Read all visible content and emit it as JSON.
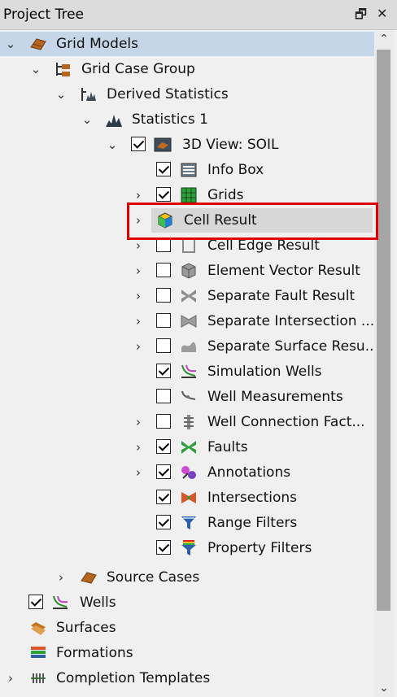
{
  "window": {
    "title": "Project Tree",
    "float_glyph": "🗗",
    "close_glyph": "✕"
  },
  "tree": [
    {
      "label": "Grid Models",
      "icon": "grid-models-icon"
    },
    {
      "label": "Grid Case Group",
      "icon": "grid-case-group-icon"
    },
    {
      "label": "Derived Statistics",
      "icon": "derived-statistics-icon"
    },
    {
      "label": "Statistics 1",
      "icon": "statistics-icon"
    },
    {
      "label": "3D View: SOIL",
      "icon": "view-3d-icon",
      "checked": true
    },
    {
      "label": "Info Box",
      "icon": "info-box-icon",
      "checked": true
    },
    {
      "label": "Grids",
      "icon": "grids-icon",
      "checked": true
    },
    {
      "label": "Cell Result",
      "icon": "cell-result-icon"
    },
    {
      "label": "Cell Edge Result",
      "icon": "cell-edge-result-icon",
      "checked": false
    },
    {
      "label": "Element Vector Result",
      "icon": "element-vector-result-icon",
      "checked": false
    },
    {
      "label": "Separate Fault Result",
      "icon": "separate-fault-result-icon",
      "checked": false
    },
    {
      "label": "Separate Intersection ...",
      "icon": "separate-intersection-icon",
      "checked": false
    },
    {
      "label": "Separate Surface Resu...",
      "icon": "separate-surface-icon",
      "checked": false
    },
    {
      "label": "Simulation Wells",
      "icon": "simulation-wells-icon",
      "checked": true
    },
    {
      "label": "Well Measurements",
      "icon": "well-measurements-icon",
      "checked": false
    },
    {
      "label": "Well Connection Fact...",
      "icon": "well-connection-icon",
      "checked": false
    },
    {
      "label": "Faults",
      "icon": "faults-icon",
      "checked": true
    },
    {
      "label": "Annotations",
      "icon": "annotations-icon",
      "checked": true
    },
    {
      "label": "Intersections",
      "icon": "intersections-icon",
      "checked": true
    },
    {
      "label": "Range Filters",
      "icon": "range-filters-icon",
      "checked": true
    },
    {
      "label": "Property Filters",
      "icon": "property-filters-icon",
      "checked": true
    },
    {
      "label": "Source Cases",
      "icon": "source-cases-icon"
    },
    {
      "label": "Wells",
      "icon": "wells-icon",
      "checked": true
    },
    {
      "label": "Surfaces",
      "icon": "surfaces-icon"
    },
    {
      "label": "Formations",
      "icon": "formations-icon"
    },
    {
      "label": "Completion Templates",
      "icon": "completion-templates-icon"
    }
  ],
  "colors": {
    "highlight": "#e00000",
    "selection": "#c4d6e8"
  }
}
